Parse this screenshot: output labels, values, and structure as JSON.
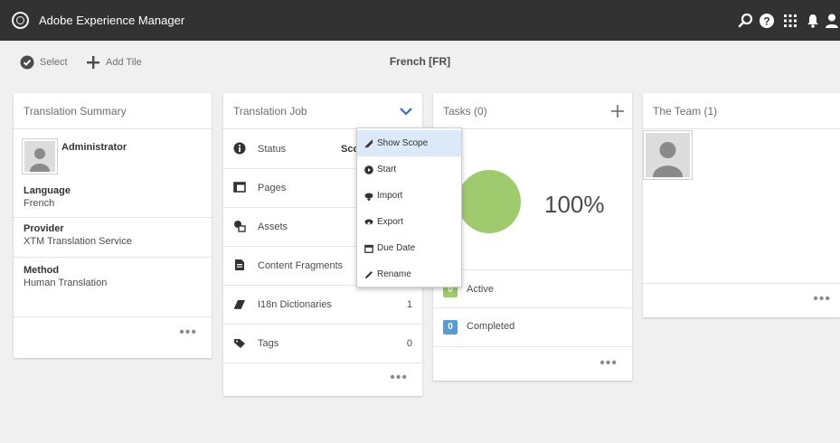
{
  "header": {
    "app_title": "Adobe Experience Manager"
  },
  "actionbar": {
    "select_label": "Select",
    "add_tile_label": "Add Tile",
    "title": "French [FR]"
  },
  "summary": {
    "title": "Translation Summary",
    "user_name": "Administrator",
    "language_label": "Language",
    "language_value": "French",
    "provider_label": "Provider",
    "provider_value": "XTM Translation Service",
    "method_label": "Method",
    "method_value": "Human Translation",
    "more": "•••"
  },
  "job": {
    "title": "Translation Job",
    "status_label": "Status",
    "status_value": "Sco",
    "rows": [
      {
        "label": "Pages",
        "count": ""
      },
      {
        "label": "Assets",
        "count": ""
      },
      {
        "label": "Content Fragments",
        "count": ""
      },
      {
        "label": "I18n Dictionaries",
        "count": "1"
      },
      {
        "label": "Tags",
        "count": "0"
      }
    ],
    "more": "•••"
  },
  "menu": {
    "items": [
      "Show Scope",
      "Start",
      "Import",
      "Export",
      "Due Date",
      "Rename"
    ]
  },
  "tasks": {
    "title": "Tasks (0)",
    "percent": "100%",
    "completion_fraction": 1.0,
    "active_count": "0",
    "active_label": "Active",
    "completed_count": "0",
    "completed_label": "Completed",
    "more": "•••"
  },
  "team": {
    "title": "The Team (1)",
    "more": "•••"
  },
  "colors": {
    "topbar": "#323232",
    "accent_blue": "#326ec8",
    "green": "#a0ca6e",
    "badge_blue": "#5b9bd5"
  }
}
